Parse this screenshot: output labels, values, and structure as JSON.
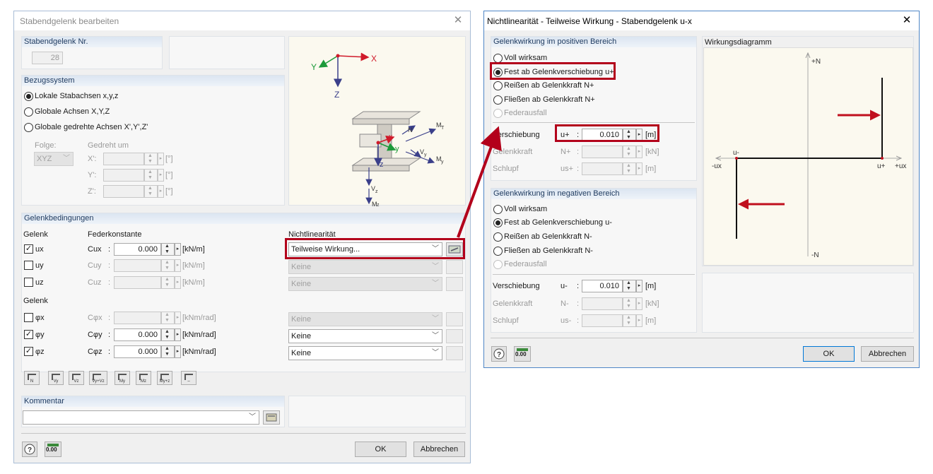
{
  "left_dialog": {
    "title": "Stabendgelenk bearbeiten",
    "hinge_no": {
      "label": "Stabendgelenk Nr.",
      "value": "28"
    },
    "reference": {
      "title": "Bezugssystem",
      "options": [
        "Lokale Stabachsen x,y,z",
        "Globale Achsen X,Y,Z",
        "Globale gedrehte Achsen X',Y',Z'"
      ],
      "selected_index": 0,
      "folge_label": "Folge:",
      "folge_value": "XYZ",
      "gedreht_label": "Gedreht um",
      "rot_labels": [
        "X':",
        "Y':",
        "Z':"
      ],
      "rot_unit": "[°]"
    },
    "figure": {
      "axis_x": "X",
      "axis_y": "Y",
      "axis_z": "Z",
      "local_x": "x",
      "local_y": "y",
      "local_z": "z",
      "n": "N",
      "vy": "V",
      "vy_sub": "y",
      "vz": "V",
      "vz_sub": "z",
      "mt": "M",
      "mt_sub": "T",
      "my": "M",
      "my_sub": "y",
      "mz": "M",
      "mz_sub": "z"
    },
    "conditions": {
      "title": "Gelenkbedingungen",
      "col_gelenk": "Gelenk",
      "col_feder": "Federkonstante",
      "col_nonlin": "Nichtlinearität",
      "col_gelenk2": "Gelenk",
      "rows": [
        {
          "checked": true,
          "name": "ux",
          "sym": "Cux",
          "value": "0.000",
          "unit": "[kN/m]",
          "nonlin": "Teilweise Wirkung...",
          "enabled": true
        },
        {
          "checked": false,
          "name": "uy",
          "sym": "Cuy",
          "value": "",
          "unit": "[kN/m]",
          "nonlin": "Keine",
          "enabled": false
        },
        {
          "checked": false,
          "name": "uz",
          "sym": "Cuz",
          "value": "",
          "unit": "[kN/m]",
          "nonlin": "Keine",
          "enabled": false
        },
        {
          "checked": false,
          "name": "φx",
          "sym": "Cφx",
          "value": "",
          "unit": "[kNm/rad]",
          "nonlin": "Keine",
          "enabled": false
        },
        {
          "checked": true,
          "name": "φy",
          "sym": "Cφy",
          "value": "0.000",
          "unit": "[kNm/rad]",
          "nonlin": "Keine",
          "enabled": true
        },
        {
          "checked": true,
          "name": "φz",
          "sym": "Cφz",
          "value": "0.000",
          "unit": "[kNm/rad]",
          "nonlin": "Keine",
          "enabled": true
        }
      ],
      "quick_buttons": [
        "N",
        "Vy",
        "Vz",
        "Vy+Vz",
        "My",
        "Mz",
        "My+z",
        "–"
      ]
    },
    "comment": {
      "title": "Kommentar",
      "value": ""
    },
    "footer": {
      "ok": "OK",
      "cancel": "Abbrechen",
      "unit_icon_text": "0.00"
    }
  },
  "right_dialog": {
    "title": "Nichtlinearität - Teilweise Wirkung - Stabendgelenk u-x",
    "positive": {
      "title": "Gelenkwirkung im positiven Bereich",
      "options": [
        "Voll wirksam",
        "Fest ab Gelenkverschiebung u+",
        "Reißen ab Gelenkkraft N+",
        "Fließen ab Gelenkkraft N+",
        "Federausfall"
      ],
      "selected_index": 1,
      "rows": [
        {
          "label": "Verschiebung",
          "sym": "u+",
          "value": "0.010",
          "unit": "[m]",
          "enabled": true
        },
        {
          "label": "Gelenkkraft",
          "sym": "N+",
          "value": "",
          "unit": "[kN]",
          "enabled": false
        },
        {
          "label": "Schlupf",
          "sym": "us+",
          "value": "",
          "unit": "[m]",
          "enabled": false
        }
      ]
    },
    "negative": {
      "title": "Gelenkwirkung im negativen Bereich",
      "options": [
        "Voll wirksam",
        "Fest ab Gelenkverschiebung u-",
        "Reißen ab Gelenkkraft N-",
        "Fließen ab Gelenkkraft N-",
        "Federausfall"
      ],
      "selected_index": 1,
      "rows": [
        {
          "label": "Verschiebung",
          "sym": "u-",
          "value": "0.010",
          "unit": "[m]",
          "enabled": true
        },
        {
          "label": "Gelenkkraft",
          "sym": "N-",
          "value": "",
          "unit": "[kN]",
          "enabled": false
        },
        {
          "label": "Schlupf",
          "sym": "us-",
          "value": "",
          "unit": "[m]",
          "enabled": false
        }
      ]
    },
    "diagram": {
      "title": "Wirkungsdiagramm",
      "plus_n": "+N",
      "minus_n": "-N",
      "minus_ux": "-ux",
      "plus_ux": "+ux",
      "u_minus": "u-",
      "u_plus": "u+"
    },
    "footer": {
      "ok": "OK",
      "cancel": "Abbrechen",
      "unit_icon_text": "0.00"
    }
  },
  "colors": {
    "highlight": "#b3001b",
    "group_header": "#dbe5f1",
    "dialog_bg": "#f0f0f0",
    "focus_border": "#0078d7"
  }
}
